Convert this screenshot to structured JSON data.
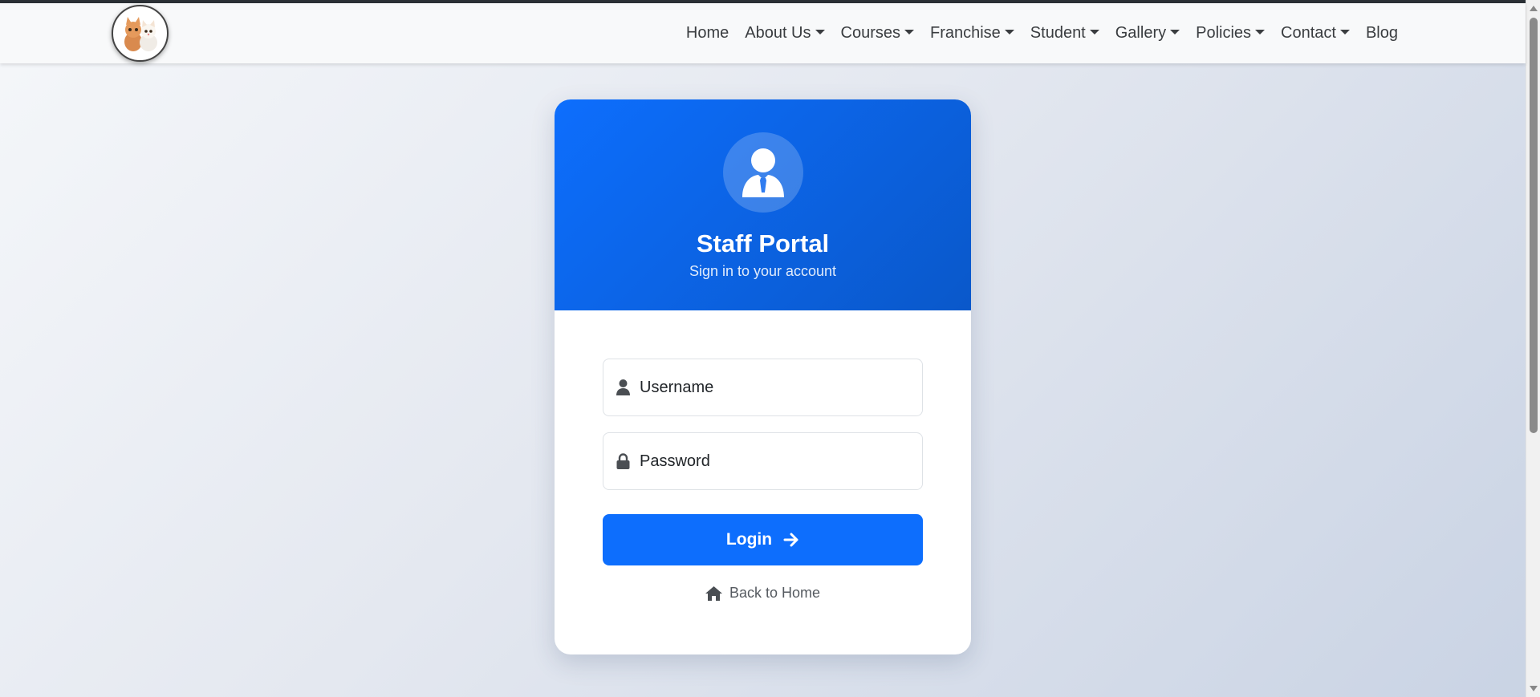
{
  "nav": {
    "logo_alt": "logo-cats",
    "items": [
      {
        "label": "Home",
        "dropdown": false
      },
      {
        "label": "About Us",
        "dropdown": true
      },
      {
        "label": "Courses",
        "dropdown": true
      },
      {
        "label": "Franchise",
        "dropdown": true
      },
      {
        "label": "Student",
        "dropdown": true
      },
      {
        "label": "Gallery",
        "dropdown": true
      },
      {
        "label": "Policies",
        "dropdown": true
      },
      {
        "label": "Contact",
        "dropdown": true
      },
      {
        "label": "Blog",
        "dropdown": false
      }
    ]
  },
  "login": {
    "title": "Staff Portal",
    "subtitle": "Sign in to your account",
    "username_placeholder": "Username",
    "password_placeholder": "Password",
    "login_label": "Login",
    "back_label": "Back to Home"
  },
  "icons": {
    "avatar": "user-tie-icon",
    "username": "user-icon",
    "password": "lock-icon",
    "login": "arrow-right-icon",
    "back": "home-icon"
  },
  "colors": {
    "primary": "#0d6efd",
    "primary_dark": "#0a58ca",
    "nav_bg": "#f8f9fa",
    "text": "#212529"
  }
}
